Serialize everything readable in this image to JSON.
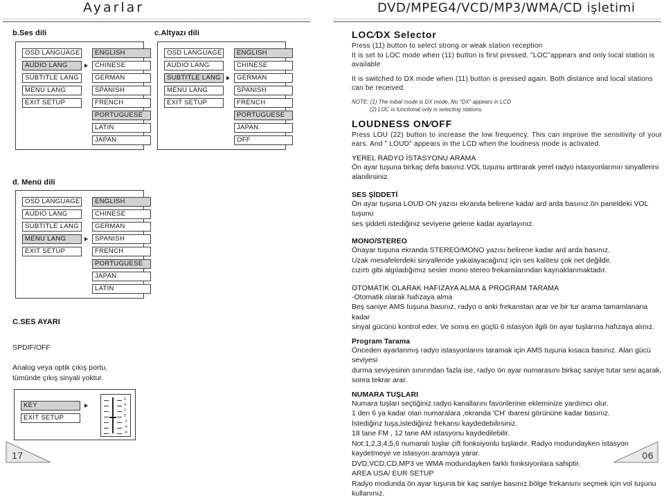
{
  "header": {
    "left_title": "Ayarlar",
    "right_title": "DVD/MPEG4/VCD/MP3/WMA/CD işletimi"
  },
  "left": {
    "section_b": {
      "label": "b.Ses dili",
      "menu_items": [
        "OSD  LANGUAGE",
        "AUDIO  LANG",
        "SUBTITLE LANG",
        "MENU LANG",
        "EXIT  SETUP"
      ],
      "menu_selected_index": 1,
      "options": [
        "ENGLISH",
        "CHINESE",
        "GERMAN",
        "SPANISH",
        "FRENCH",
        "PORTUGUESE",
        "LATIN",
        "JAPAN"
      ],
      "options_highlighted": [
        0,
        5
      ]
    },
    "section_c": {
      "label": "c.Altyazı dili",
      "menu_items": [
        "OSD  LANGUAGE",
        "AUDIO  LANG",
        "SUBTITLE LANG",
        "MENU LANG",
        "EXIT  SETUP"
      ],
      "menu_selected_index": 2,
      "options": [
        "ENGLISH",
        "CHINESE",
        "GERMAN",
        "SPANISH",
        "FRENCH",
        "PORTUGUESE",
        "JAPAN",
        "OFF"
      ],
      "options_highlighted": [
        0,
        5
      ]
    },
    "section_d": {
      "label": "d. Menü dili",
      "menu_items": [
        "OSD  LANGUAGE",
        "AUDIO  LANG",
        "SUBTITLE LANG",
        "MENU LANG",
        "EXIT  SETUP"
      ],
      "menu_selected_index": 3,
      "options": [
        "ENGLISH",
        "CHINESE",
        "GERMAN",
        "SPANISH",
        "FRENCH",
        "PORTUGUESE",
        "JAPAN",
        "LATIN"
      ],
      "options_highlighted": [
        0,
        5
      ]
    },
    "section_ses_ayari": {
      "title": "C.SES AYARI",
      "subtitle": "SPDIF/OFF",
      "body_line_1": "Analog veya optik çıkış portu,",
      "body_line_2": "tümünde çıkış sinyali yoktur.",
      "key_items": [
        "KEY",
        "EXIT  SETUP"
      ],
      "key_selected_index": 0,
      "eq_values": [
        "6",
        "4",
        "2",
        "0",
        "-2",
        "-4",
        "-6"
      ],
      "eq_knob_index": 3
    }
  },
  "right": {
    "loc_dx": {
      "heading": "LOC∕DX Selector",
      "p1": "Press (11) button to select strong or weak station reception",
      "p2": "It is set to LOC mode when (11) button is first pressed. ʺLOCʺappears and only local station is available",
      "p3": "It is switched to DX mode when (11) button is pressed again. Both distance and local stations can be received.",
      "note1": "NOTE: (1) The initial mode is DX mode, No ʺDXʺ appears in LCD",
      "note2": "(2) LOC is functional only is selecting stations."
    },
    "loudness": {
      "heading": "LOUDNESS ON∕OFF",
      "p1": "Press LOU (22) button to increase the low frequency.  This can improve the sensitivity of your ears.  And ʺ LOUDʺ appears in the LCD when the loudness mode  is  activated."
    },
    "yerel_radyo": {
      "heading": "YEREL RADYO İSTASYONU ARAMA",
      "p1": " Ön ayar tuşuna birkaç defa basınız.VOL tuşunu arttırarak yerel radyo istasyonlarının sinyallerini",
      "p2": "alanilirsiniz."
    },
    "ses_siddeti": {
      "heading": "SES ŞİDDETİ",
      "p1": "Ön ayar tuşuna LOUD ON yazısı ekranda belirene kadar ard arda basınız.ön paneldeki VOL tuşunu",
      "p2": "ses şiddeti istediğiniz seviyene gelene kadar ayarlayınız."
    },
    "mono_stereo": {
      "heading": "MONO/STEREO",
      "p1": "Önayar tuşuna  ekranda STEREO/MONO yazısı belirene kadar ard arda basınız.",
      "p2": "Uzak mesafelerdeki sinyalleride yakalayacağınız için ses kalitesi çok net değildir.",
      "p3": "cızırtı gibi algıladığımız sesler mono stereo frekanslarından kaynaklanmaktadır."
    },
    "otomatik": {
      "heading": "OTOMATİK OLARAK HAFIZAYA ALMA & PROGRAM TARAMA",
      "p1": "-Otomatik olarak hafızaya alma",
      "p2": "Beş saniye AMS tuşuna basınız, radyo o anki frekanstan arar ve bir tur arama tamamlanana kadar",
      "p3": "sinyal gücünü kontrol eder. Ve sonra en güçlü 6 istasyon ilgili ön ayar tuşlarına hafızaya alınız."
    },
    "program_tarama": {
      "heading": "Program Tarama",
      "p1": "Önceden ayarlanmış radyo istasyonlarını taramak için AMS tuşuna kısaca basınız. Alan gücü seviyesi",
      "p2": "durma seviyesinin sınırından fazla ise, radyo ön ayar numarasını birkaç saniye tutar sesi açarak,",
      "p3": "sonra tekrar arar."
    },
    "numara_tuslari": {
      "heading": "NUMARA TUŞLARI",
      "p1": "Numara tuşları  seçtiğiniz radyo kanallarını favorilerinie ekleminize yardımcı olur.",
      "p2": "1 den 6 ya kadar olan numaralara ,ekranda 'CH' ibaresi görününe kadar basınız.",
      "p3": "İstediğinz tuşa,istediğiniz frekansı kaydedebilirsiniz.",
      "p4": "18 tane FM , 12 tane AM istasyonu kaydedilebilir.",
      "p5": "Not:1,2,3,4,5,6 numaralı tuşlar çift fonksiyonlu tuşlardır. Radyo modundayken istasyon",
      "p6": "kaydetmeye ve istasyon aramaya yarar.",
      "p7": "DVD,VCD,CD,MP3 ve WMA modundayken farklı fonksiyonlara sahiptir.",
      "p8": "AREA USA/ EUR SETUP",
      "p9": "Radyo modunda ön ayar tuşuna bir kaç saniye basınız.bölge frekansını seçmek için vol tuşunu kullanınız."
    }
  },
  "footer": {
    "page_left": "17",
    "page_right": "06"
  }
}
